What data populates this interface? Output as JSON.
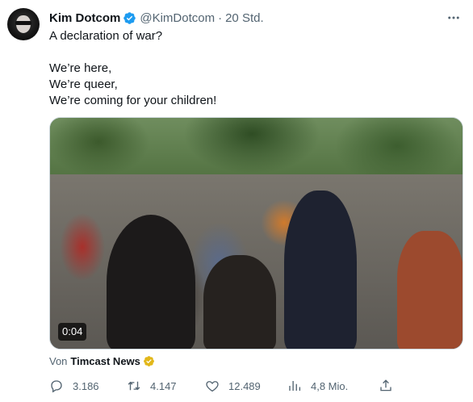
{
  "tweet": {
    "author_name": "Kim Dotcom",
    "handle": "@KimDotcom",
    "separator": "·",
    "time": "20 Std.",
    "lines": [
      "A declaration of war?",
      "",
      "We’re here,",
      "We’re queer,",
      "We’re coming for your children!"
    ]
  },
  "media": {
    "duration": "0:04"
  },
  "source": {
    "prefix": "Von",
    "name": "Timcast News"
  },
  "actions": {
    "replies": "3.186",
    "retweets": "4.147",
    "likes": "12.489",
    "views": "4,8 Mio."
  },
  "colors": {
    "verified_blue": "#1d9bf0",
    "verified_gold": "#e2b719",
    "secondary_text": "#536471"
  },
  "icons": {
    "more": "more-dots-icon",
    "reply": "reply-icon",
    "retweet": "retweet-icon",
    "like": "heart-icon",
    "views": "views-bar-chart-icon",
    "share": "share-icon"
  }
}
